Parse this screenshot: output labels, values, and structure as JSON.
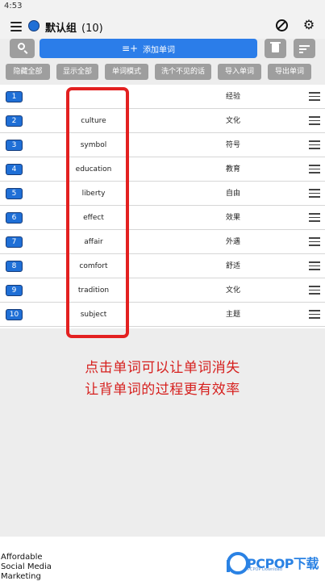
{
  "status_bar": {
    "time": "4:53"
  },
  "header": {
    "title": "默认组",
    "count": "(10)"
  },
  "toolbar": {
    "add_label": "添加单词",
    "add_icon": "≡+"
  },
  "chips": [
    {
      "label": "隐藏全部"
    },
    {
      "label": "显示全部"
    },
    {
      "label": "单词模式"
    },
    {
      "label": "洗个不见的话"
    },
    {
      "label": "导入单词"
    },
    {
      "label": "导出单词"
    }
  ],
  "words": [
    {
      "num": "1",
      "word": "",
      "meaning": "经验"
    },
    {
      "num": "2",
      "word": "culture",
      "meaning": "文化"
    },
    {
      "num": "3",
      "word": "symbol",
      "meaning": "符号"
    },
    {
      "num": "4",
      "word": "education",
      "meaning": "教育"
    },
    {
      "num": "5",
      "word": "liberty",
      "meaning": "自由"
    },
    {
      "num": "6",
      "word": "effect",
      "meaning": "效果"
    },
    {
      "num": "7",
      "word": "affair",
      "meaning": "外遇"
    },
    {
      "num": "8",
      "word": "comfort",
      "meaning": "舒适"
    },
    {
      "num": "9",
      "word": "tradition",
      "meaning": "文化"
    },
    {
      "num": "10",
      "word": "subject",
      "meaning": "主题"
    }
  ],
  "annotation": {
    "line1": "点击单词可以让单词消失",
    "line2": "让背单词的过程更有效率"
  },
  "ad": {
    "text": "Affordable Social Media Marketing"
  },
  "watermark": {
    "brand": "PCPOP下载",
    "sub": "PCPOP Download"
  },
  "colors": {
    "accent": "#2b7de9",
    "badge": "#1f6fd6",
    "highlight": "#e32020",
    "chip": "#9e9e9e"
  }
}
